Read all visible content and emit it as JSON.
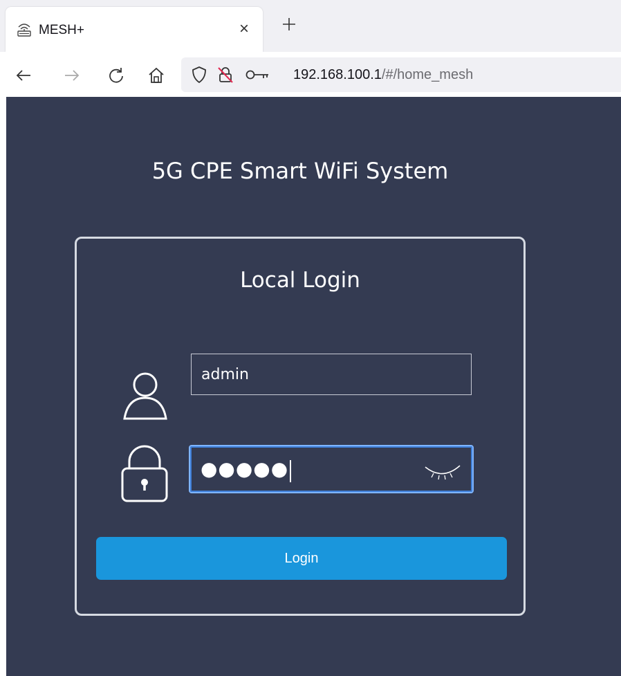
{
  "browser": {
    "tab": {
      "title": "MESH+",
      "close_glyph": "×",
      "icon": "router-icon"
    },
    "new_tab_glyph": "+",
    "url": {
      "host": "192.168.100.1",
      "path": "/#/home_mesh"
    }
  },
  "page": {
    "site_title": "5G CPE Smart WiFi System",
    "card_title": "Local Login",
    "username": {
      "value": "admin"
    },
    "password": {
      "masked_value": "●●●●●"
    },
    "login_label": "Login"
  },
  "colors": {
    "page_background": "#343b52",
    "button": "#1a96dc",
    "card_border": "#d6dae2",
    "focus_ring": "#3f7fd8"
  }
}
